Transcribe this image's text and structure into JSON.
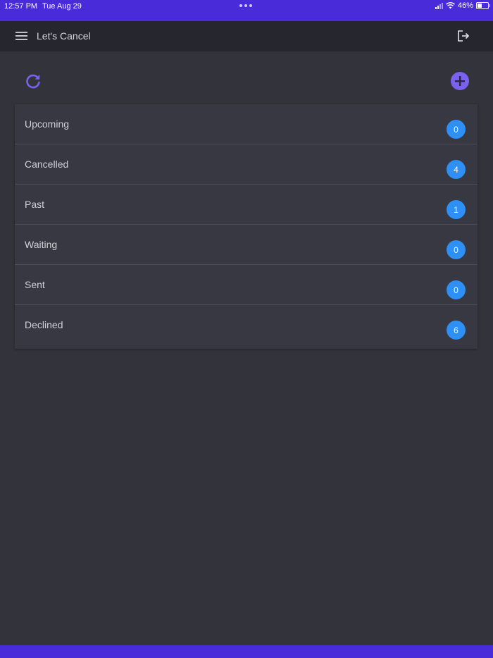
{
  "status_bar": {
    "time": "12:57 PM",
    "date": "Tue Aug 29",
    "battery": "46%",
    "battery_level": 0.46
  },
  "app_bar": {
    "title": "Let's Cancel"
  },
  "icons": {
    "menu": "hamburger-menu-icon",
    "logout": "logout-icon",
    "refresh": "refresh-icon",
    "add": "plus-icon"
  },
  "colors": {
    "accent": "#4a2bd9",
    "action": "#7b61f0",
    "badge": "#2e8ff5",
    "background": "#32333b",
    "surface": "#373841"
  },
  "categories": [
    {
      "label": "Upcoming",
      "count": "0"
    },
    {
      "label": "Cancelled",
      "count": "4"
    },
    {
      "label": "Past",
      "count": "1"
    },
    {
      "label": "Waiting",
      "count": "0"
    },
    {
      "label": "Sent",
      "count": "0"
    },
    {
      "label": "Declined",
      "count": "6"
    }
  ]
}
